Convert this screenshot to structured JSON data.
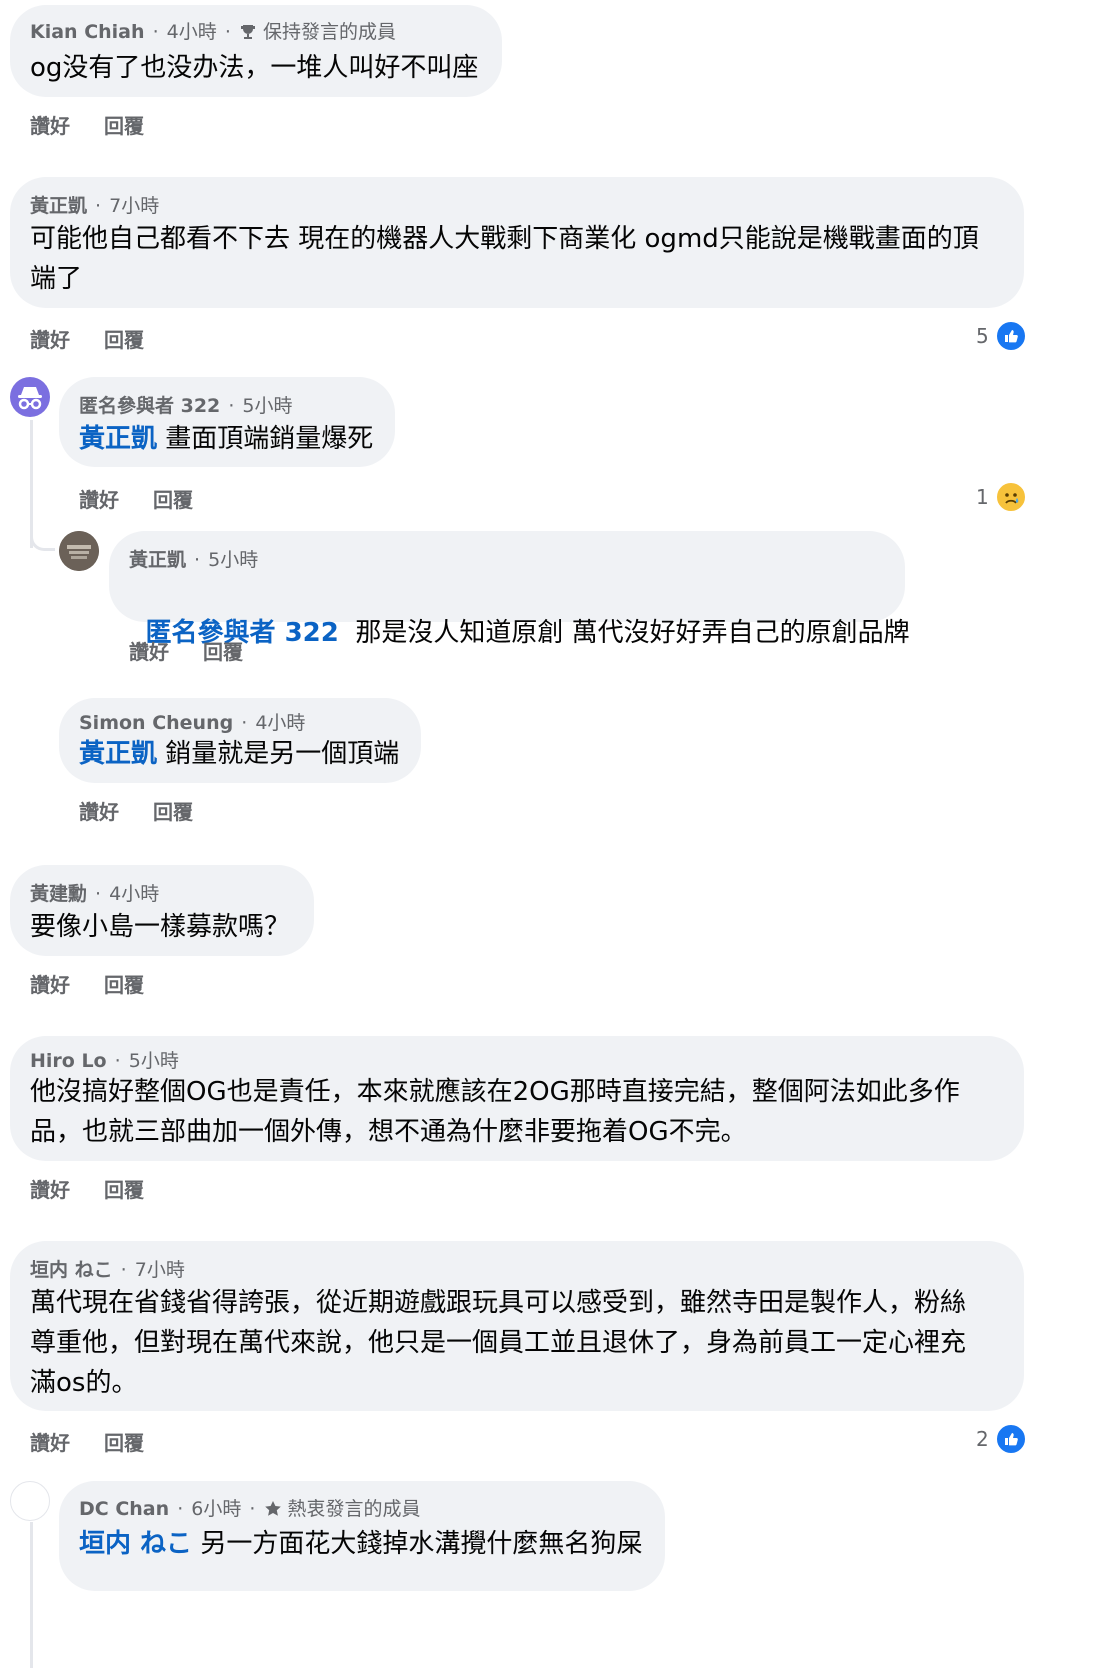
{
  "actions": {
    "like": "讚好",
    "reply": "回覆"
  },
  "comments": [
    {
      "name": "Kian  Chiah",
      "time": "4小時",
      "badge": "保持發言的成員",
      "text": "og没有了也没办法，一堆人叫好不叫座"
    },
    {
      "name": "黃正凱",
      "time": "7小時",
      "text_line1": "可能他自己都看不下去 現在的機器人大戰剩下商業化 ogmd只能說是機戰畫面的頂",
      "text_line2": "端了",
      "reactions": "5"
    },
    {
      "name": "匿名參與者 322",
      "time": "5小時",
      "mention": "黃正凱",
      "text": " 畫面頂端銷量爆死",
      "reactions": "1"
    },
    {
      "name": "黃正凱",
      "time": "5小時",
      "mention": "匿名參與者 322",
      "text": "  那是沒人知道原創 萬代沒好好弄自己的原創品牌"
    },
    {
      "name": "Simon Cheung",
      "time": "4小時",
      "mention": "黃正凱",
      "text": " 銷量就是另一個頂端"
    },
    {
      "name": "黃建勳",
      "time": "4小時",
      "text": "要像小島一樣募款嗎？"
    },
    {
      "name": "Hiro Lo",
      "time": "5小時",
      "text_line1": "他沒搞好整個OG也是責任，本來就應該在2OG那時直接完結，整個阿法如此多作",
      "text_line2": "品，也就三部曲加一個外傳，想不通為什麼非要拖着OG不完。"
    },
    {
      "name": "垣内 ねこ",
      "time": "7小時",
      "text_line1": "萬代現在省錢省得誇張，從近期遊戲跟玩具可以感受到，雖然寺田是製作人，粉絲",
      "text_line2": "尊重他，但對現在萬代來說，他只是一個員工並且退休了，身為前員工一定心裡充",
      "text_line3": "滿os的。",
      "reactions": "2"
    },
    {
      "name": "DC  Chan",
      "time": "6小時",
      "badge": "熱衷發言的成員",
      "mention": "垣内 ねこ",
      "text": " 另一方面花大錢掉水溝攪什麼無名狗屎"
    }
  ],
  "colors": {
    "bubble": "#f0f2f5",
    "mention": "#0b63c4",
    "meta": "#65676b",
    "like": "#1877f2",
    "anon": "#7b6fe0"
  }
}
